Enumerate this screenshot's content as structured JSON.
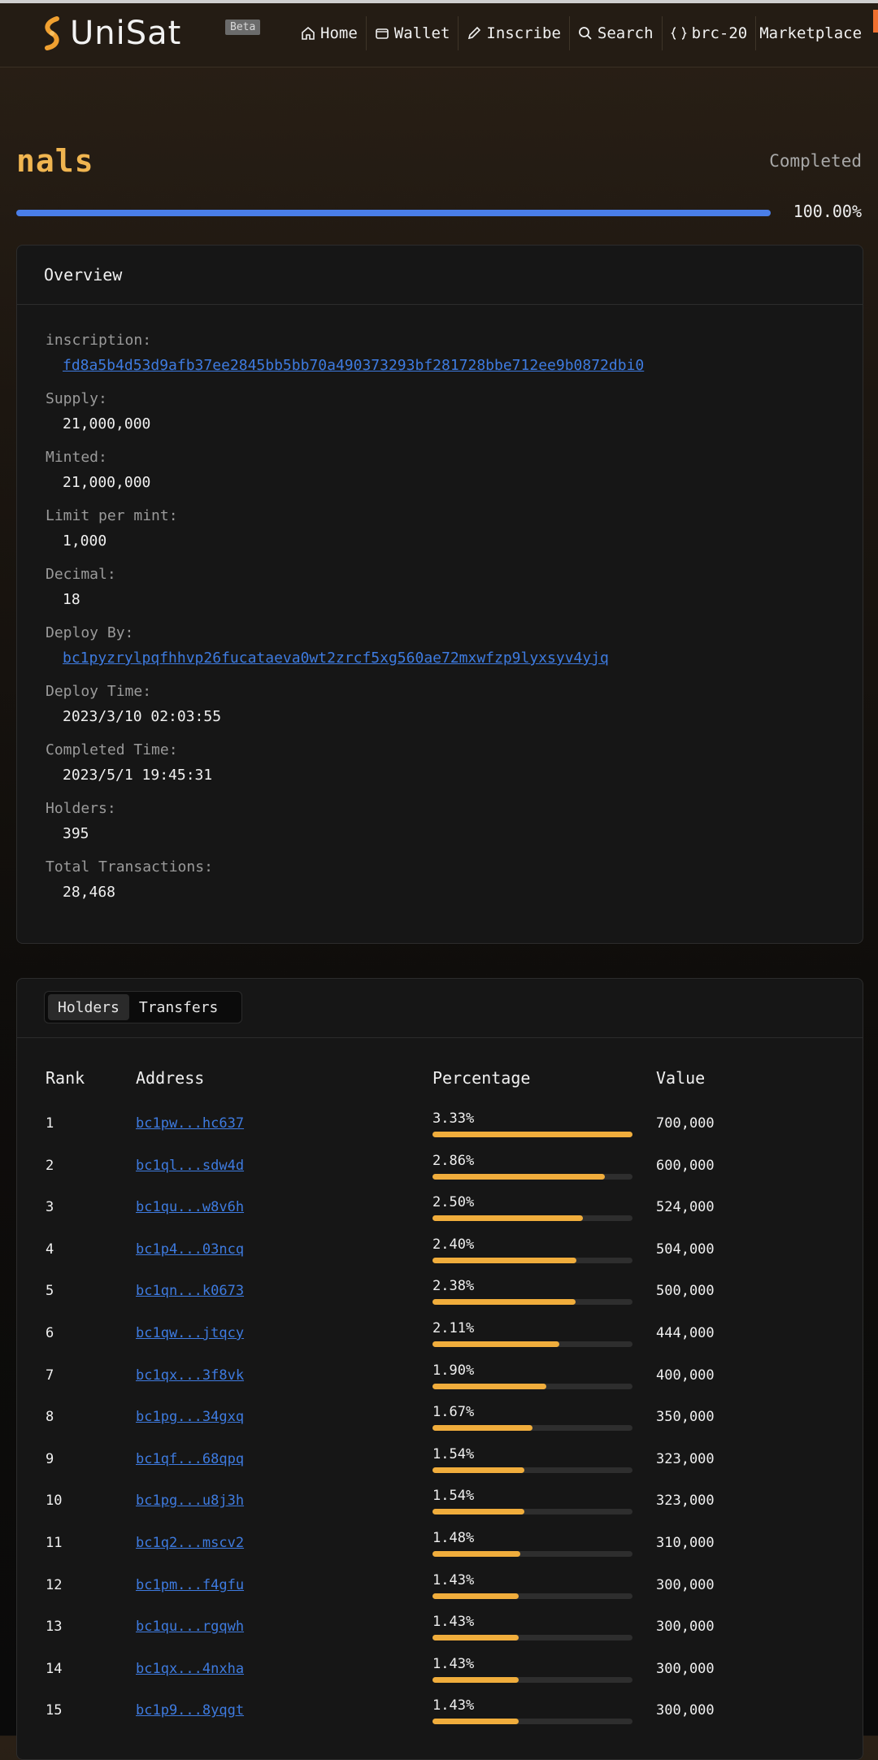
{
  "nav": {
    "brand": "UniSat",
    "beta": "Beta",
    "items": [
      {
        "label": "Home",
        "icon": "home-icon"
      },
      {
        "label": "Wallet",
        "icon": "wallet-icon"
      },
      {
        "label": "Inscribe",
        "icon": "pencil-icon"
      },
      {
        "label": "Search",
        "icon": "search-icon"
      },
      {
        "label": "brc-20",
        "icon": "braces-icon"
      },
      {
        "label": "Marketplace",
        "icon": ""
      }
    ]
  },
  "token": {
    "name": "nals",
    "status": "Completed",
    "progress_text": "100.00%",
    "progress": 1.0
  },
  "overview": {
    "title": "Overview",
    "fields": [
      {
        "label": "inscription:",
        "value": "fd8a5b4d53d9afb37ee2845bb5bb70a490373293bf281728bbe712ee9b0872dbi0",
        "link": true
      },
      {
        "label": "Supply:",
        "value": "21,000,000",
        "link": false
      },
      {
        "label": "Minted:",
        "value": "21,000,000",
        "link": false
      },
      {
        "label": "Limit per mint:",
        "value": "1,000",
        "link": false
      },
      {
        "label": "Decimal:",
        "value": "18",
        "link": false
      },
      {
        "label": "Deploy By:",
        "value": "bc1pyzrylpqfhhvp26fucataeva0wt2zrcf5xg560ae72mxwfzp9lyxsyv4yjq",
        "link": true
      },
      {
        "label": "Deploy Time:",
        "value": "2023/3/10 02:03:55",
        "link": false
      },
      {
        "label": "Completed Time:",
        "value": "2023/5/1 19:45:31",
        "link": false
      },
      {
        "label": "Holders:",
        "value": "395",
        "link": false
      },
      {
        "label": "Total Transactions:",
        "value": "28,468",
        "link": false
      }
    ]
  },
  "holders": {
    "tabs": [
      "Holders",
      "Transfers"
    ],
    "columns": {
      "rank": "Rank",
      "address": "Address",
      "percentage": "Percentage",
      "value": "Value"
    },
    "rows": [
      {
        "rank": "1",
        "address": "bc1pw...hc637",
        "pct": "3.33%",
        "fill": 1.0,
        "value": "700,000"
      },
      {
        "rank": "2",
        "address": "bc1ql...sdw4d",
        "pct": "2.86%",
        "fill": 0.86,
        "value": "600,000"
      },
      {
        "rank": "3",
        "address": "bc1qu...w8v6h",
        "pct": "2.50%",
        "fill": 0.75,
        "value": "524,000"
      },
      {
        "rank": "4",
        "address": "bc1p4...03ncq",
        "pct": "2.40%",
        "fill": 0.72,
        "value": "504,000"
      },
      {
        "rank": "5",
        "address": "bc1qn...k0673",
        "pct": "2.38%",
        "fill": 0.715,
        "value": "500,000"
      },
      {
        "rank": "6",
        "address": "bc1qw...jtqcy",
        "pct": "2.11%",
        "fill": 0.635,
        "value": "444,000"
      },
      {
        "rank": "7",
        "address": "bc1qx...3f8vk",
        "pct": "1.90%",
        "fill": 0.57,
        "value": "400,000"
      },
      {
        "rank": "8",
        "address": "bc1pg...34gxq",
        "pct": "1.67%",
        "fill": 0.5,
        "value": "350,000"
      },
      {
        "rank": "9",
        "address": "bc1qf...68qpq",
        "pct": "1.54%",
        "fill": 0.46,
        "value": "323,000"
      },
      {
        "rank": "10",
        "address": "bc1pg...u8j3h",
        "pct": "1.54%",
        "fill": 0.46,
        "value": "323,000"
      },
      {
        "rank": "11",
        "address": "bc1q2...mscv2",
        "pct": "1.48%",
        "fill": 0.44,
        "value": "310,000"
      },
      {
        "rank": "12",
        "address": "bc1pm...f4gfu",
        "pct": "1.43%",
        "fill": 0.43,
        "value": "300,000"
      },
      {
        "rank": "13",
        "address": "bc1qu...rgqwh",
        "pct": "1.43%",
        "fill": 0.43,
        "value": "300,000"
      },
      {
        "rank": "14",
        "address": "bc1qx...4nxha",
        "pct": "1.43%",
        "fill": 0.43,
        "value": "300,000"
      },
      {
        "rank": "15",
        "address": "bc1p9...8yqgt",
        "pct": "1.43%",
        "fill": 0.43,
        "value": "300,000"
      }
    ]
  },
  "colors": {
    "accent": "#f0b550",
    "progress": "#4a7ee8",
    "bar": "#f0ad3c",
    "link": "#3e7be0"
  }
}
